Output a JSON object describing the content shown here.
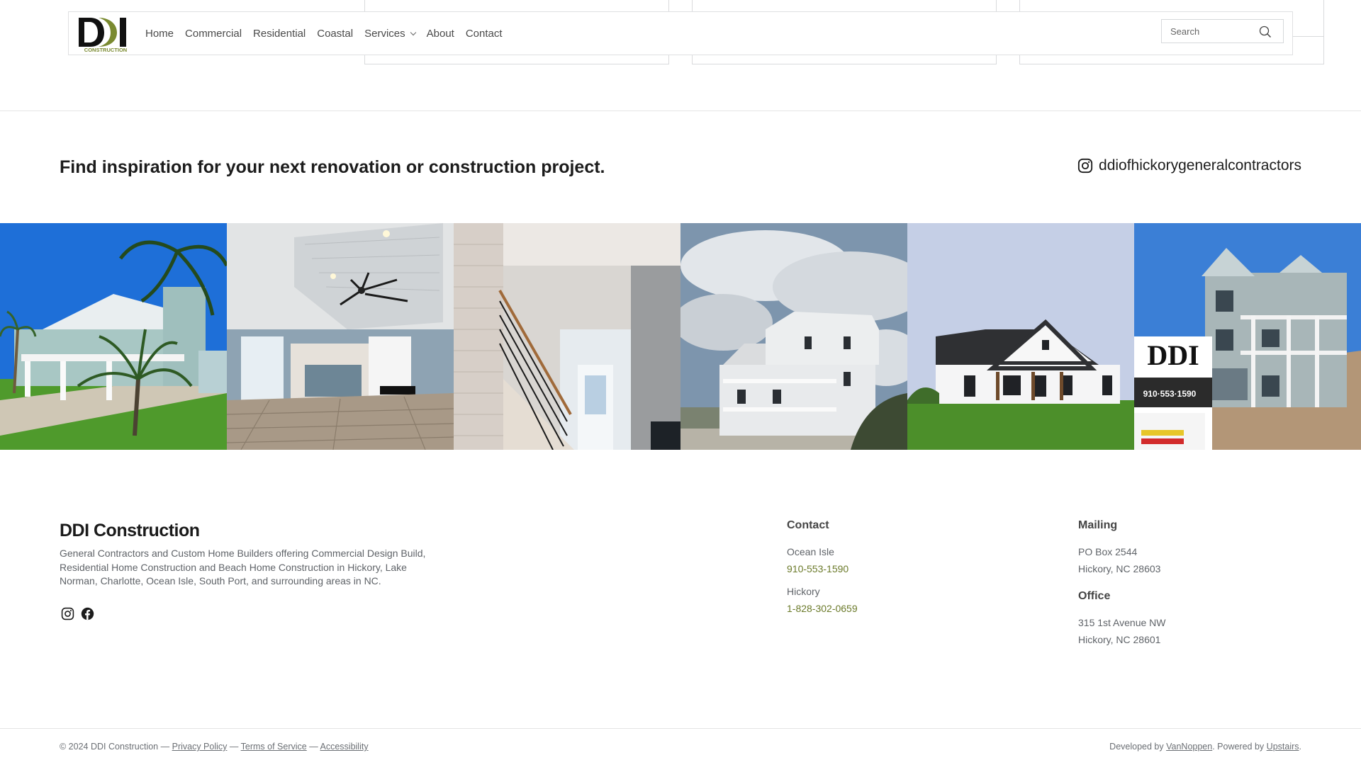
{
  "header": {
    "logo_text": "DDI",
    "logo_subtext": "CONSTRUCTION",
    "nav": [
      {
        "label": "Home"
      },
      {
        "label": "Commercial"
      },
      {
        "label": "Residential"
      },
      {
        "label": "Coastal"
      },
      {
        "label": "Services",
        "has_dropdown": true
      },
      {
        "label": "About"
      },
      {
        "label": "Contact"
      }
    ],
    "search": {
      "placeholder": "Search",
      "value": ""
    }
  },
  "inspiration": {
    "heading": "Find inspiration for your next renovation or construction project.",
    "instagram_handle": "ddiofhickorygeneralcontractors"
  },
  "gallery": {
    "photos": [
      {
        "subject": "Coastal house with palm trees"
      },
      {
        "subject": "Open interior with ceiling fan and kitchen"
      },
      {
        "subject": "Staircase and front door entry"
      },
      {
        "subject": "Three-story beach house under cloudy sky"
      },
      {
        "subject": "White farmhouse with dark roof"
      },
      {
        "subject": "Construction site with DDI sign"
      }
    ]
  },
  "footer": {
    "brand": "DDI Construction",
    "description": "General Contractors and Custom Home Builders offering Commercial Design Build, Residential Home Construction and Beach Home Construction in Hickory, Lake Norman, Charlotte, Ocean Isle, South Port, and surrounding areas in NC.",
    "contact": {
      "heading": "Contact",
      "locations": [
        {
          "name": "Ocean Isle",
          "phone": "910-553-1590"
        },
        {
          "name": "Hickory",
          "phone": "1-828-302-0659"
        }
      ]
    },
    "mailing": {
      "heading": "Mailing",
      "line1": "PO Box 2544",
      "line2": "Hickory, NC 28603"
    },
    "office": {
      "heading": "Office",
      "line1": "315 1st Avenue NW",
      "line2": "Hickory, NC 28601"
    },
    "copyright": "© 2024 DDI Construction",
    "sep": "—",
    "links": {
      "privacy": "Privacy Policy",
      "terms": "Terms of Service",
      "accessibility": "Accessibility"
    },
    "credits": {
      "developed_prefix": "Developed by",
      "developer": "VanNoppen",
      "powered_prefix": ". Powered by",
      "platform": "Upstairs",
      "suffix": "."
    }
  },
  "colors": {
    "accent_olive": "#7a8a30",
    "phone_green": "#6b7a2a",
    "text_dark": "#1c1c1c",
    "text_muted": "#5f6368",
    "border": "#dfe0e2"
  }
}
